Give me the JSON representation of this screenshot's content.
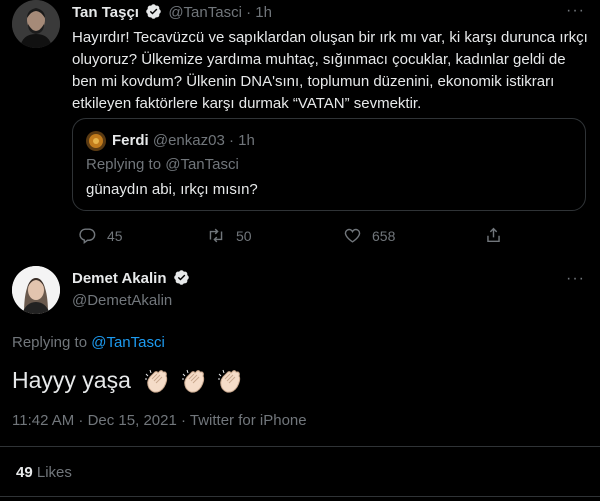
{
  "tweet1": {
    "display_name": "Tan Taşçı",
    "handle": "@TanTasci",
    "separator": "·",
    "time": "1h",
    "more": "···",
    "text": "Hayırdır! Tecavüzcü ve sapıklardan oluşan bir ırk mı var, ki karşı durunca ırkçı oluyoruz? Ülkemize yardıma muhtaç, sığınmacı çocuklar, kadınlar geldi de ben mi kovdum? Ülkenin DNA'sını, toplumun düzenini, ekonomik istikrarı etkileyen faktörlere karşı durmak “VATAN” sevmektir.",
    "quoted": {
      "display_name": "Ferdi",
      "handle": "@enkaz03",
      "separator": "·",
      "time": "1h",
      "replying_to": "Replying to @TanTasci",
      "text": "günaydın abi, ırkçı mısın?"
    },
    "actions": {
      "replies": "45",
      "retweets": "50",
      "likes": "658"
    }
  },
  "tweet2": {
    "display_name": "Demet Akalin",
    "handle": "@DemetAkalin",
    "more": "···",
    "replying_prefix": "Replying to",
    "replying_handle": "@TanTasci",
    "text": "Hayyy yaşa",
    "emoji": [
      "clapping-hands",
      "clapping-hands",
      "clapping-hands"
    ],
    "timestamp": "11:42 AM · Dec 15, 2021 · Twitter for iPhone",
    "likes_count": "49",
    "likes_label": "Likes"
  },
  "colors": {
    "background": "#000000",
    "text": "#e7e9ea",
    "muted": "#71767b",
    "link": "#1d9bf0",
    "border": "#2f3336"
  }
}
